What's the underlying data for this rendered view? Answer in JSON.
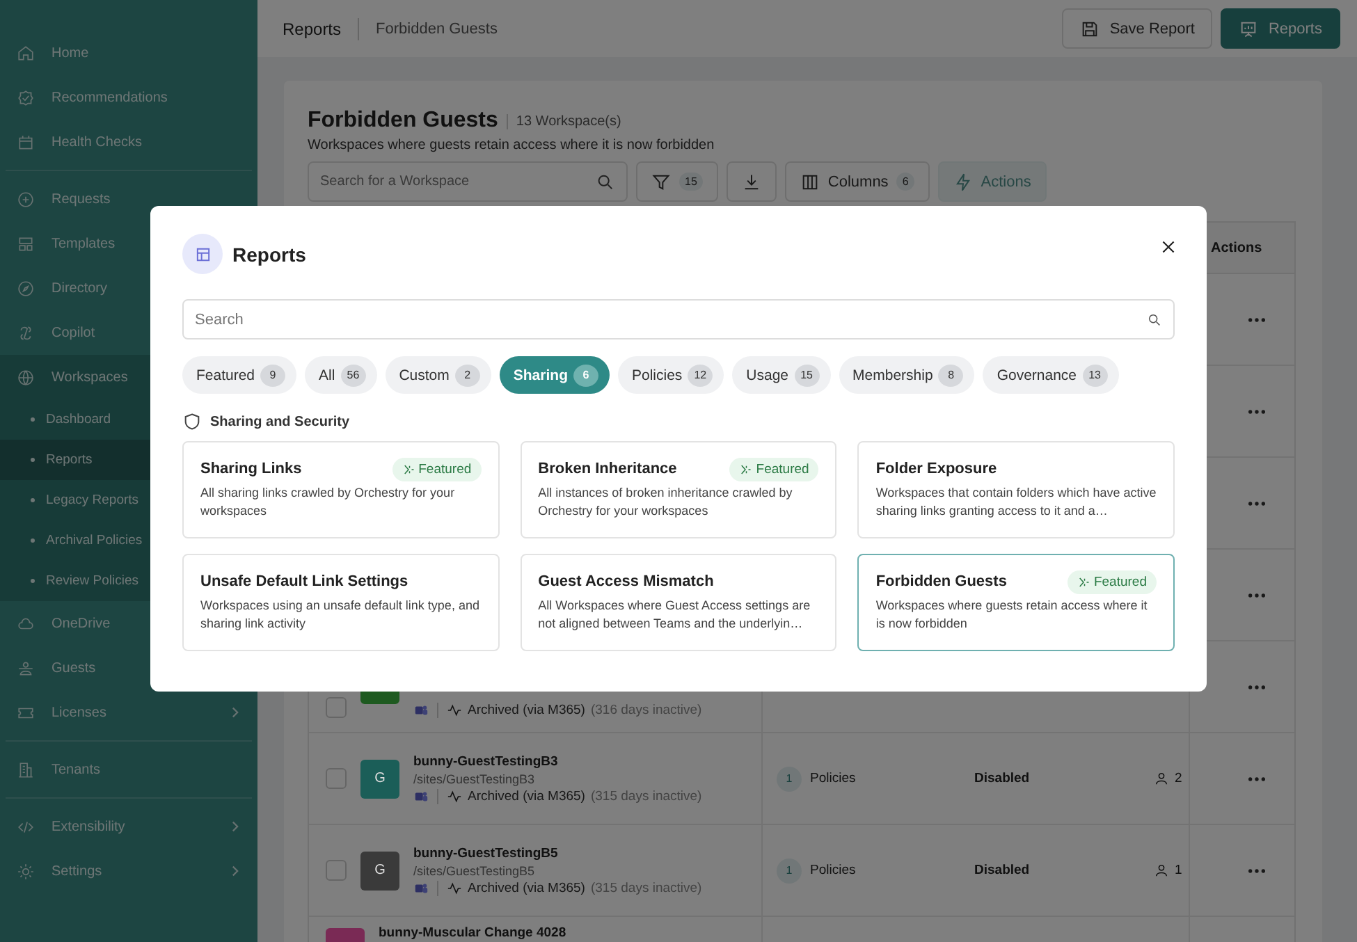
{
  "sidebar": {
    "sections": [
      [
        {
          "label": "Home",
          "selected": false,
          "submenu": false
        },
        {
          "label": "Recommendations",
          "selected": false,
          "submenu": false
        },
        {
          "label": "Health Checks",
          "selected": false,
          "submenu": false
        }
      ],
      [
        {
          "label": "Requests",
          "selected": false
        },
        {
          "label": "Templates",
          "selected": false
        },
        {
          "label": "Directory",
          "selected": false
        },
        {
          "label": "Copilot",
          "selected": false
        },
        {
          "label": "Workspaces",
          "selected": false,
          "expanded": true,
          "children": [
            {
              "label": "Dashboard",
              "selected": false
            },
            {
              "label": "Reports",
              "selected": true
            },
            {
              "label": "Legacy Reports",
              "selected": false
            },
            {
              "label": "Archival Policies",
              "selected": false
            },
            {
              "label": "Review Policies",
              "selected": false
            }
          ]
        },
        {
          "label": "OneDrive",
          "selected": false
        },
        {
          "label": "Guests",
          "selected": false
        },
        {
          "label": "Licenses",
          "selected": false,
          "submenu": true
        }
      ],
      [
        {
          "label": "Tenants",
          "selected": false,
          "submenu": false
        }
      ],
      [
        {
          "label": "Extensibility",
          "selected": false,
          "submenu": true
        },
        {
          "label": "Settings",
          "selected": false,
          "submenu": true
        }
      ]
    ]
  },
  "breadcrumb": [
    "Reports",
    "Forbidden Guests"
  ],
  "top_buttons": {
    "save": "Save Report",
    "reports": "Reports"
  },
  "report": {
    "title": "Forbidden Guests",
    "count": "13 Workspace(s)",
    "description": "Workspaces where guests retain access where it is now forbidden",
    "search_placeholder": "Search for a Workspace",
    "filter_count": "15",
    "columns_label": "Columns",
    "columns_count": "6",
    "actions_label": "Actions",
    "actions_disabled": true
  },
  "table": {
    "actions_header": "Actions",
    "rows": [
      {
        "kind": "covered"
      },
      {
        "kind": "covered"
      },
      {
        "kind": "covered"
      },
      {
        "kind": "covered"
      },
      {
        "kind": "partial",
        "color": "#1e5a20",
        "checked": false,
        "status": "Archived (via M365)",
        "inactive": "(316 days inactive)"
      },
      {
        "kind": "full",
        "color": "#1b5e58",
        "checked": false,
        "avatar": "G",
        "name": "bunny-GuestTestingB3",
        "path": "/sites/GuestTestingB3",
        "status": "Archived (via M365)",
        "inactive": "(315 days inactive)",
        "policy_count": "1",
        "policy_label": "Policies",
        "guest_access": "Disabled",
        "members": "2"
      },
      {
        "kind": "full",
        "color": "#3a3a3a",
        "checked": false,
        "avatar": "G",
        "name": "bunny-GuestTestingB5",
        "path": "/sites/GuestTestingB5",
        "status": "Archived (via M365)",
        "inactive": "(315 days inactive)",
        "policy_count": "1",
        "policy_label": "Policies",
        "guest_access": "Disabled",
        "members": "1"
      },
      {
        "kind": "cut",
        "color": "#7a2a55",
        "name": "bunny-Muscular Change 4028"
      }
    ]
  },
  "modal": {
    "title": "Reports",
    "search_placeholder": "Search",
    "chips": [
      {
        "label": "Featured",
        "count": "9",
        "selected": false
      },
      {
        "label": "All",
        "count": "56",
        "selected": false
      },
      {
        "label": "Custom",
        "count": "2",
        "selected": false
      },
      {
        "label": "Sharing",
        "count": "6",
        "selected": true
      },
      {
        "label": "Policies",
        "count": "12",
        "selected": false
      },
      {
        "label": "Usage",
        "count": "15",
        "selected": false
      },
      {
        "label": "Membership",
        "count": "8",
        "selected": false
      },
      {
        "label": "Governance",
        "count": "13",
        "selected": false
      }
    ],
    "section": "Sharing and Security",
    "cards": [
      {
        "title": "Sharing Links",
        "badge": "Featured",
        "description": "All sharing links crawled by Orchestry for your workspaces",
        "selected": false
      },
      {
        "title": "Broken Inheritance",
        "badge": "Featured",
        "description": "All instances of broken inheritance crawled by Orchestry for your workspaces",
        "selected": false
      },
      {
        "title": "Folder Exposure",
        "description": "Workspaces that contain folders which have active sharing links granting access to it and a…",
        "selected": false
      },
      {
        "title": "Unsafe Default Link Settings",
        "description": "Workspaces using an unsafe default link type, and sharing link activity",
        "selected": false
      },
      {
        "title": "Guest Access Mismatch",
        "description": "All Workspaces where Guest Access settings are not aligned between Teams and the underlyin…",
        "selected": false
      },
      {
        "title": "Forbidden Guests",
        "badge": "Featured",
        "description": "Workspaces where guests retain access where it is now forbidden",
        "selected": true
      }
    ]
  }
}
